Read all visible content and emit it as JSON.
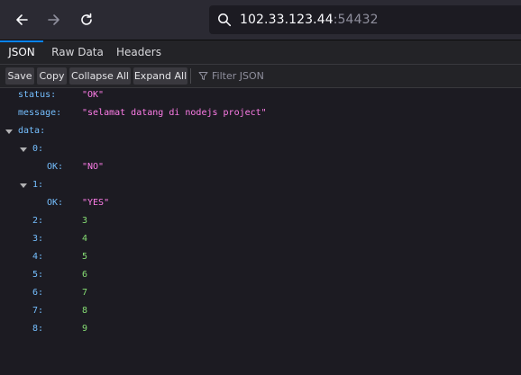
{
  "browser": {
    "url_host": "102.33.123.44",
    "url_port": ":54432"
  },
  "tabs": [
    {
      "label": "JSON",
      "active": true
    },
    {
      "label": "Raw Data",
      "active": false
    },
    {
      "label": "Headers",
      "active": false
    }
  ],
  "json_toolbar": {
    "save": "Save",
    "copy": "Copy",
    "collapse_all": "Collapse All",
    "expand_all": "Expand All",
    "filter_placeholder": "Filter JSON"
  },
  "tree": {
    "status_key": "status:",
    "status_value": "\"OK\"",
    "message_key": "message:",
    "message_value": "\"selamat datang di nodejs project\"",
    "data_key": "data:",
    "item0_key": "0:",
    "item0_ok_key": "OK:",
    "item0_ok_value": "\"NO\"",
    "item1_key": "1:",
    "item1_ok_key": "OK:",
    "item1_ok_value": "\"YES\"",
    "numbers": [
      {
        "key": "2:",
        "value": "3"
      },
      {
        "key": "3:",
        "value": "4"
      },
      {
        "key": "4:",
        "value": "5"
      },
      {
        "key": "5:",
        "value": "6"
      },
      {
        "key": "6:",
        "value": "7"
      },
      {
        "key": "7:",
        "value": "8"
      },
      {
        "key": "8:",
        "value": "9"
      }
    ]
  },
  "colors": {
    "key": "#75bfff",
    "string": "#ff7de9",
    "number": "#86de74",
    "accent": "#0a84ff"
  }
}
